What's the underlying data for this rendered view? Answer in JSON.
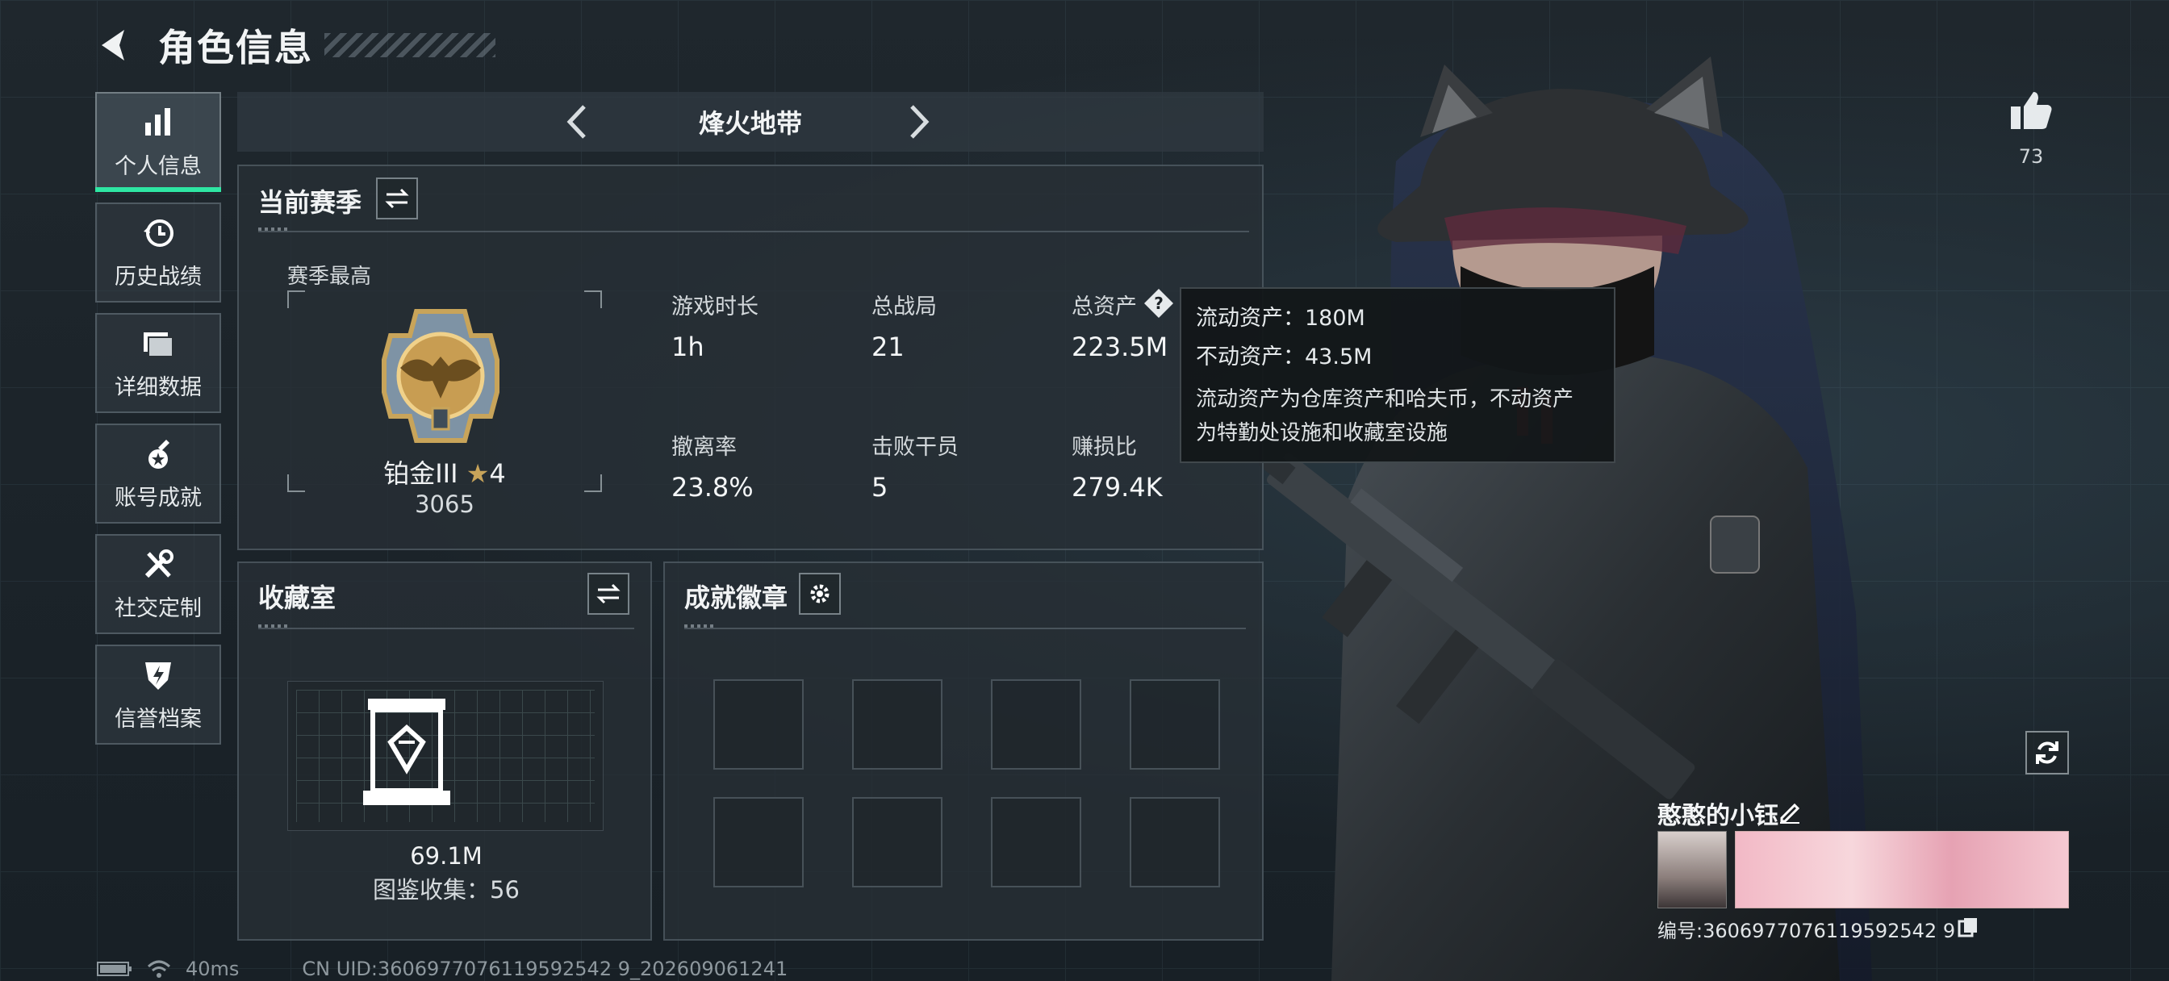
{
  "header": {
    "title": "角色信息"
  },
  "sidebar": {
    "items": [
      {
        "label": "个人信息",
        "icon": "bar-chart-icon",
        "active": true
      },
      {
        "label": "历史战绩",
        "icon": "history-clock-icon",
        "active": false
      },
      {
        "label": "详细数据",
        "icon": "folder-stack-icon",
        "active": false
      },
      {
        "label": "账号成就",
        "icon": "medal-star-icon",
        "active": false
      },
      {
        "label": "社交定制",
        "icon": "wrench-screwdriver-icon",
        "active": false
      },
      {
        "label": "信誉档案",
        "icon": "shield-bolt-icon",
        "active": false
      }
    ]
  },
  "mode": {
    "title": "烽火地带"
  },
  "season": {
    "title": "当前赛季",
    "best_label": "赛季最高",
    "rank_name": "铂金III",
    "rank_stars": "4",
    "rank_score": "3065",
    "stats": [
      {
        "label": "游戏时长",
        "value": "1h"
      },
      {
        "label": "总战局",
        "value": "21"
      },
      {
        "label": "总资产",
        "value": "223.5M"
      },
      {
        "label": "撤离率",
        "value": "23.8%"
      },
      {
        "label": "击败干员",
        "value": "5"
      },
      {
        "label": "赚损比",
        "value": "279.4K"
      }
    ]
  },
  "tooltip": {
    "liquid": "流动资产：180M",
    "fixed": "不动资产：43.5M",
    "desc_line1": "流动资产为仓库资产和哈夫币，不动资产",
    "desc_line2": "为特勤处设施和收藏室设施"
  },
  "collection": {
    "title": "收藏室",
    "value": "69.1M",
    "count": "图鉴收集：56"
  },
  "achievement": {
    "title": "成就徽章",
    "slots": 8
  },
  "social": {
    "likes": "73"
  },
  "player": {
    "name": "憨憨的小钰",
    "id": "编号:3606977076119592542 9"
  },
  "footer": {
    "ping": "40ms",
    "uid": "CN UID:3606977076119592542 9_202609061241"
  },
  "colors": {
    "accent": "#2ee6a3",
    "background": "#1b2227",
    "gold": "#c8a45a"
  }
}
